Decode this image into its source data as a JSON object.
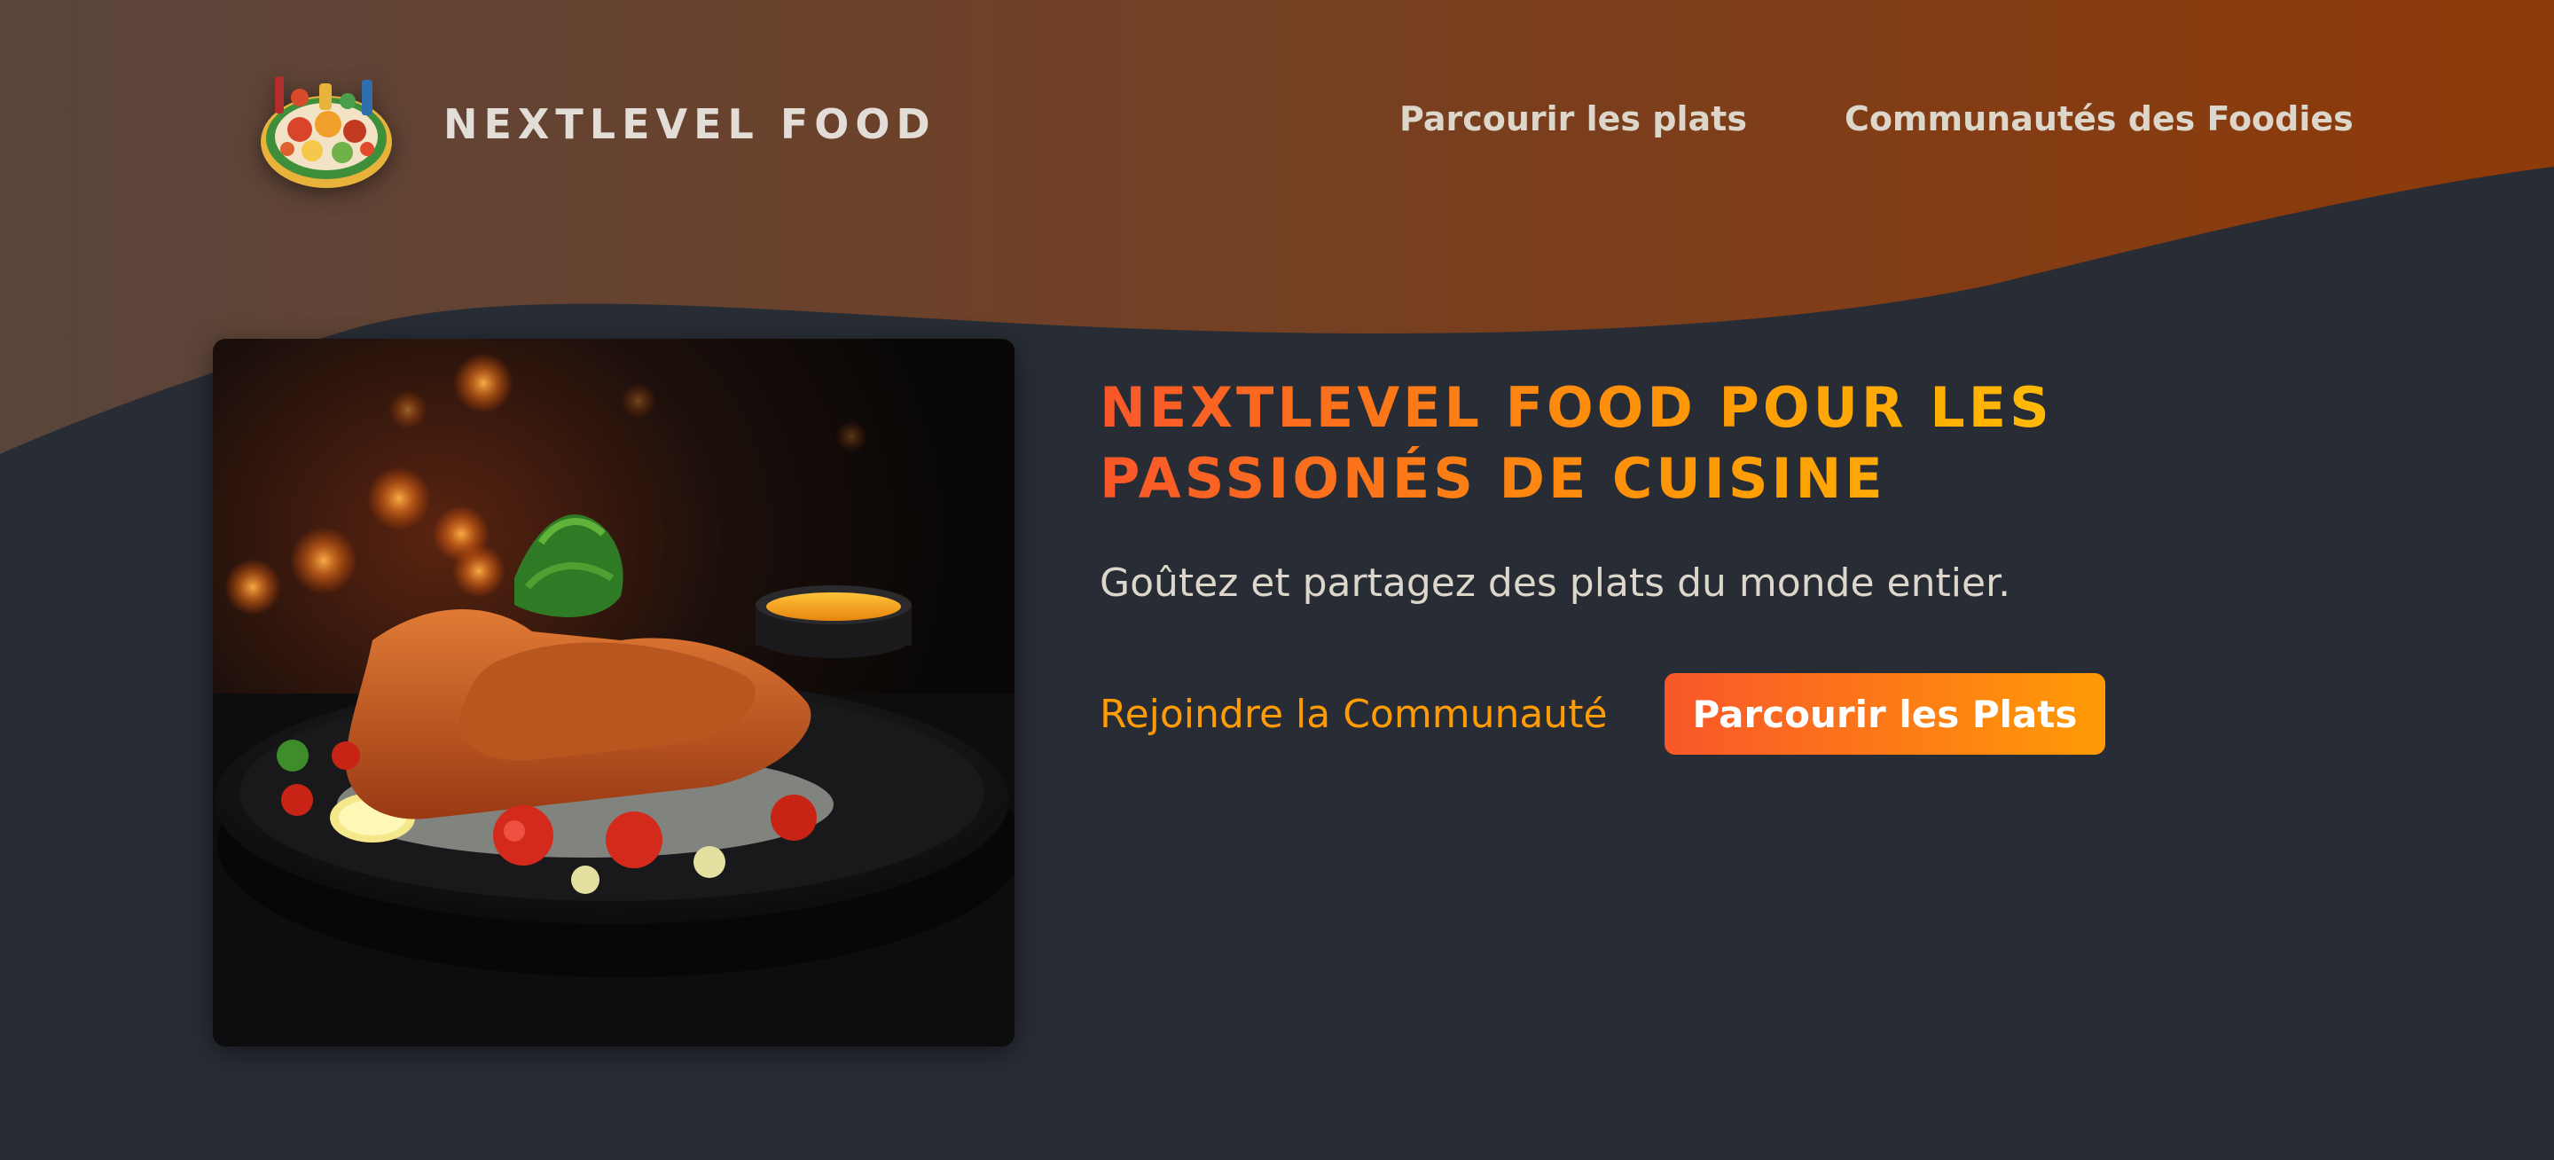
{
  "header": {
    "logo_icon": "food-platter-icon",
    "brand": "NEXTLEVEL FOOD",
    "nav": [
      {
        "label": "Parcourir les plats"
      },
      {
        "label": "Communautés des Foodies"
      }
    ]
  },
  "hero": {
    "image": "schnitzel-plate-photo",
    "title": "NEXTLEVEL FOOD POUR LES PASSIONÉS DE CUISINE",
    "subtitle": "Goûtez et partagez des plats du monde entier.",
    "cta_link": "Rejoindre la Communauté",
    "cta_button": "Parcourir les Plats"
  },
  "colors": {
    "background": "#282c34",
    "header_gradient_start": "#59453c",
    "header_gradient_end": "#8f3a09",
    "accent_orange": "#ff9b05",
    "accent_red": "#f9572a",
    "nav_text": "#ddd6cb"
  }
}
